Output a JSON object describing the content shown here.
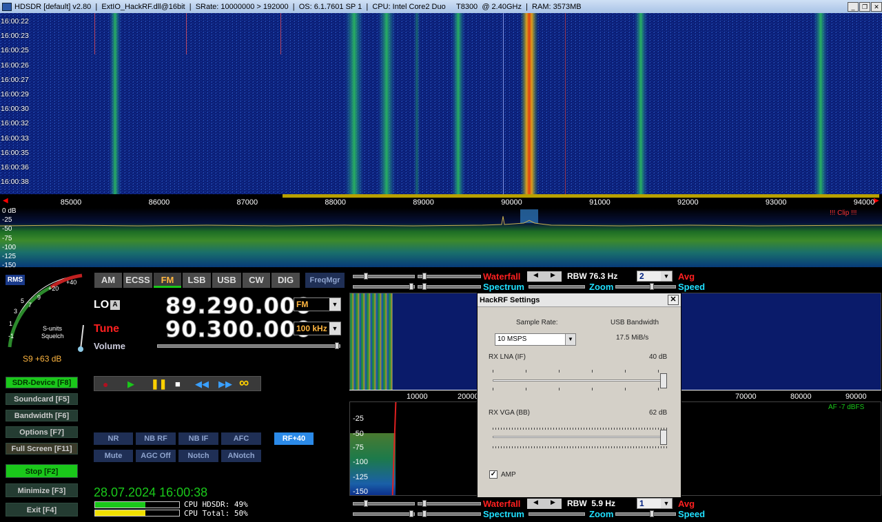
{
  "title": {
    "app": "HDSDR",
    "config": "[default]",
    "version": "v2.80",
    "extio": "ExtIO_HackRF.dll@16bit",
    "srate": "SRate: 10000000 > 192000",
    "os": "OS: 6.1.7601 SP 1",
    "cpu": "CPU: Intel Core2 Duo",
    "cpu_model": "T8300",
    "cpu_speed": "@ 2.40GHz",
    "ram": "RAM: 3573MB"
  },
  "waterfall": {
    "timestamps": [
      "16:00:22",
      "16:00:23",
      "16:00:25",
      "16:00:26",
      "16:00:27",
      "16:00:29",
      "16:00:30",
      "16:00:32",
      "16:00:33",
      "16:00:35",
      "16:00:36",
      "16:00:38"
    ]
  },
  "freq_scale": [
    "85000",
    "86000",
    "87000",
    "88000",
    "89000",
    "90000",
    "91000",
    "92000",
    "93000",
    "94000"
  ],
  "spectrum": {
    "db_labels": [
      "0 dB",
      "-25",
      "-50",
      "-75",
      "-100",
      "-125",
      "-150"
    ],
    "clip": "!!! Clip !!!"
  },
  "smeter": {
    "rms": "RMS",
    "scale": [
      "-1",
      "1",
      "3",
      "5",
      "7",
      "9",
      "+20",
      "+40"
    ],
    "units": "S-units",
    "squelch": "Squelch",
    "reading": "S9 +63 dB"
  },
  "modes": [
    {
      "label": "AM"
    },
    {
      "label": "ECSS"
    },
    {
      "label": "FM"
    },
    {
      "label": "LSB"
    },
    {
      "label": "USB"
    },
    {
      "label": "CW"
    },
    {
      "label": "DIG"
    }
  ],
  "freqmgr": "FreqMgr",
  "lo": {
    "label": "LO",
    "lock": "A",
    "value": "89.290.000",
    "mode": "FM"
  },
  "tune": {
    "label": "Tune",
    "value": "90.300.000",
    "step": "100 kHz"
  },
  "volume": "Volume",
  "left_buttons": [
    "SDR-Device [F8]",
    "Soundcard [F5]",
    "Bandwidth [F6]",
    "Options [F7]",
    "Full Screen [F11]",
    "Stop [F2]",
    "Minimize [F3]",
    "Exit [F4]"
  ],
  "dsp_row1": [
    "NR",
    "NB RF",
    "NB IF",
    "AFC",
    "RF+40"
  ],
  "dsp_row2": [
    "Mute",
    "AGC Off",
    "Notch",
    "ANotch"
  ],
  "datetime": "28.07.2024 16:00:38",
  "cpu": {
    "hdsdr": "CPU HDSDR: 49%",
    "total": "CPU Total: 50%",
    "hdsdr_pct": 49,
    "total_pct": 50
  },
  "rf_panel": {
    "waterfall": "Waterfall",
    "spectrum": "Spectrum",
    "rbw": "RBW 76.3 Hz",
    "avg_value": "2",
    "avg": "Avg",
    "zoom": "Zoom",
    "speed": "Speed"
  },
  "af_panel": {
    "waterfall": "Waterfall",
    "spectrum": "Spectrum",
    "rbw": "RBW  5.9 Hz",
    "avg_value": "1",
    "avg": "Avg",
    "zoom": "Zoom",
    "speed": "Speed",
    "af_level": "AF  -7 dBFS",
    "freq_labels": [
      "10000",
      "20000",
      "70000",
      "80000",
      "90000"
    ],
    "db_labels": [
      "-25",
      "-50",
      "-75",
      "-100",
      "-125",
      "-150"
    ]
  },
  "dialog": {
    "title": "HackRF Settings",
    "sample_rate_label": "Sample Rate:",
    "sample_rate": "10 MSPS",
    "usb_label": "USB Bandwidth",
    "usb_value": "17.5 MiB/s",
    "lna_label": "RX LNA (IF)",
    "lna_value": "40 dB",
    "vga_label": "RX VGA (BB)",
    "vga_value": "62 dB",
    "amp_label": "AMP",
    "amp_checked": true
  }
}
